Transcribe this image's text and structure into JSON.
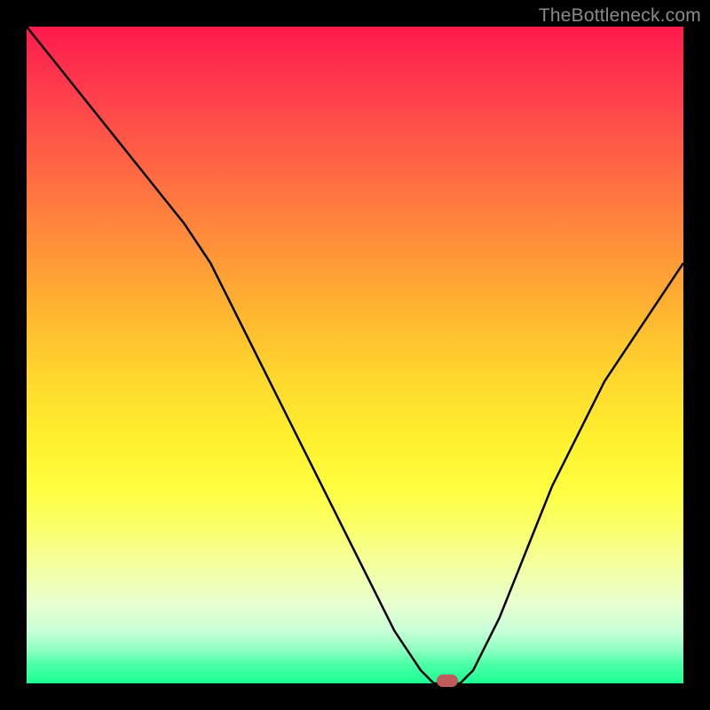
{
  "watermark": "TheBottleneck.com",
  "chart_data": {
    "type": "line",
    "title": "",
    "xlabel": "",
    "ylabel": "",
    "xlim": [
      0,
      100
    ],
    "ylim": [
      0,
      100
    ],
    "x": [
      0,
      4,
      8,
      12,
      16,
      20,
      24,
      28,
      32,
      36,
      40,
      44,
      48,
      52,
      56,
      60,
      62,
      64,
      66,
      68,
      72,
      76,
      80,
      84,
      88,
      92,
      96,
      100
    ],
    "values": [
      100,
      95,
      90,
      85,
      80,
      75,
      70,
      64,
      56,
      48,
      40,
      32,
      24,
      16,
      8,
      2,
      0,
      0,
      0,
      2,
      10,
      20,
      30,
      38,
      46,
      52,
      58,
      64
    ],
    "min_x": 64,
    "marker_color": "#c05b5b",
    "line_color": "#000000"
  }
}
